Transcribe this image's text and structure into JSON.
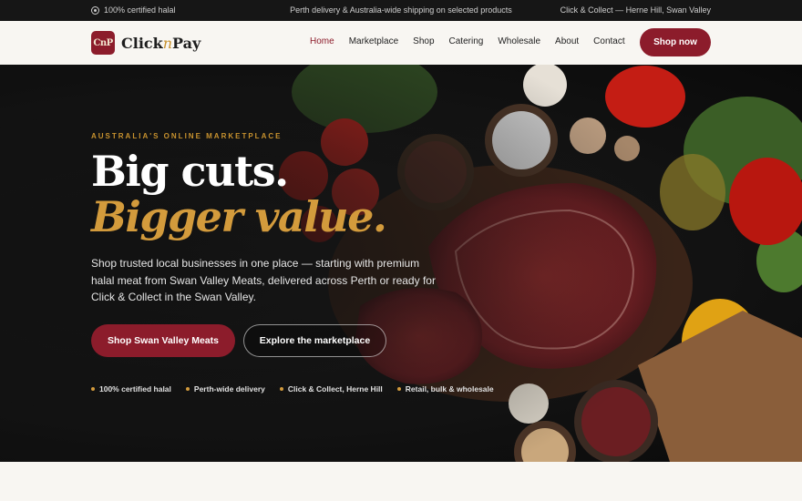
{
  "topbar": {
    "left": "100% certified halal",
    "center": "Perth delivery & Australia-wide shipping on selected products",
    "right": "Click & Collect — Herne Hill, Swan Valley"
  },
  "brand": {
    "mark": "CnP",
    "name_a": "Click",
    "name_n": "n",
    "name_b": "Pay"
  },
  "nav": {
    "items": [
      "Home",
      "Marketplace",
      "Shop",
      "Catering",
      "Wholesale",
      "About",
      "Contact"
    ],
    "active": "Home",
    "cta": "Shop now"
  },
  "hero": {
    "eyebrow": "AUSTRALIA'S ONLINE MARKETPLACE",
    "headline": "Big cuts.",
    "headline_accent": "Bigger value.",
    "lead": "Shop trusted local businesses in one place — starting with premium halal meat from Swan Valley Meats, delivered across Perth or ready for Click & Collect in the Swan Valley.",
    "primary_cta": "Shop Swan Valley Meats",
    "secondary_cta": "Explore the marketplace",
    "perks": [
      "100% certified halal",
      "Perth-wide delivery",
      "Click & Collect, Herne Hill",
      "Retail, bulk & wholesale"
    ]
  },
  "colors": {
    "brand": "#8c1c2b",
    "accent": "#c8922e",
    "dark": "#161616"
  }
}
